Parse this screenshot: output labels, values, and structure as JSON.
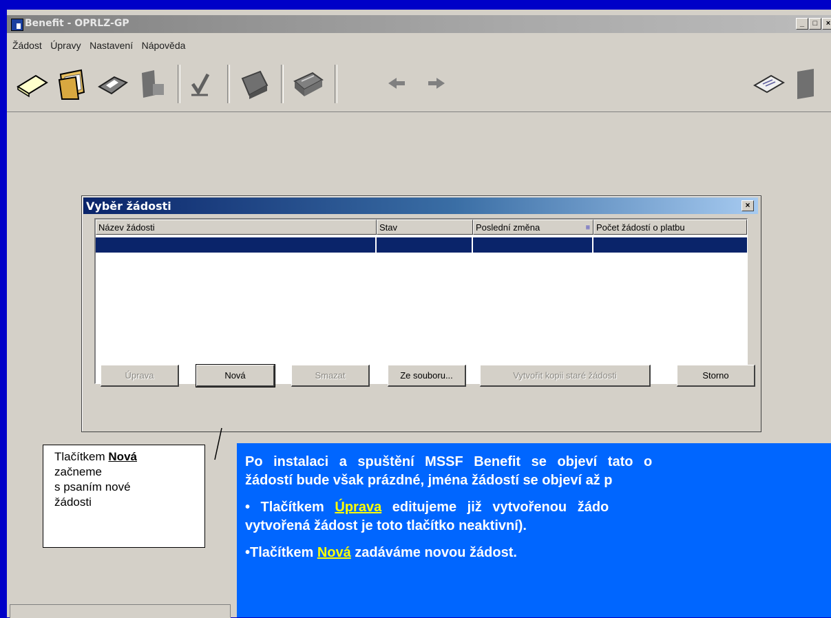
{
  "window": {
    "title": "Benefit - OPRLZ-GP",
    "controls": {
      "minimize": "_",
      "maximize": "□",
      "close": "×"
    }
  },
  "menu": {
    "items": [
      "Žádost",
      "Úpravy",
      "Nastavení",
      "Nápověda"
    ]
  },
  "toolbar": {
    "icons": [
      "new-document-icon",
      "open-folder-icon",
      "save-icon",
      "export-icon",
      "check-icon",
      "print-setup-icon",
      "print-icon",
      "back-arrow-icon",
      "forward-arrow-icon",
      "paper-icon",
      "book-icon"
    ]
  },
  "dialog": {
    "title": "Vyběr žádosti",
    "close": "×",
    "columns": [
      "Název žádosti",
      "Stav",
      "Poslední změna",
      "Počet žádostí o platbu"
    ],
    "buttons": {
      "edit": "Úprava",
      "new": "Nová",
      "delete": "Smazat",
      "from_file": "Ze souboru...",
      "copy": "Vytvořit kopii staré žádosti",
      "cancel": "Storno"
    }
  },
  "callout": {
    "line1_prefix": "Tlačítkem ",
    "line1_bold": "Nová",
    "line2": "začneme",
    "line3": "s psaním nové",
    "line4": "žádosti"
  },
  "info": {
    "p1_line1": "Po instalaci a spuštění MSSF Benefit se objeví tato o",
    "p1_line2": "žádostí bude však prázdné, jména žádostí se objeví až p",
    "p2_prefix": "• Tlačítkem ",
    "p2_highlight": "Úprava",
    "p2_suffix": " editujeme již vytvořenou žádo",
    "p2_line2": "vytvořená žádost je toto tlačítko neaktivní).",
    "p3_prefix": "•Tlačítkem ",
    "p3_highlight": "Nová",
    "p3_suffix": "  zadáváme novou žádost."
  },
  "colors": {
    "background": "#0000c8",
    "window": "#d4d0c8",
    "selection": "#0a246a",
    "info_box": "#0066ff",
    "highlight": "#ffff00"
  }
}
